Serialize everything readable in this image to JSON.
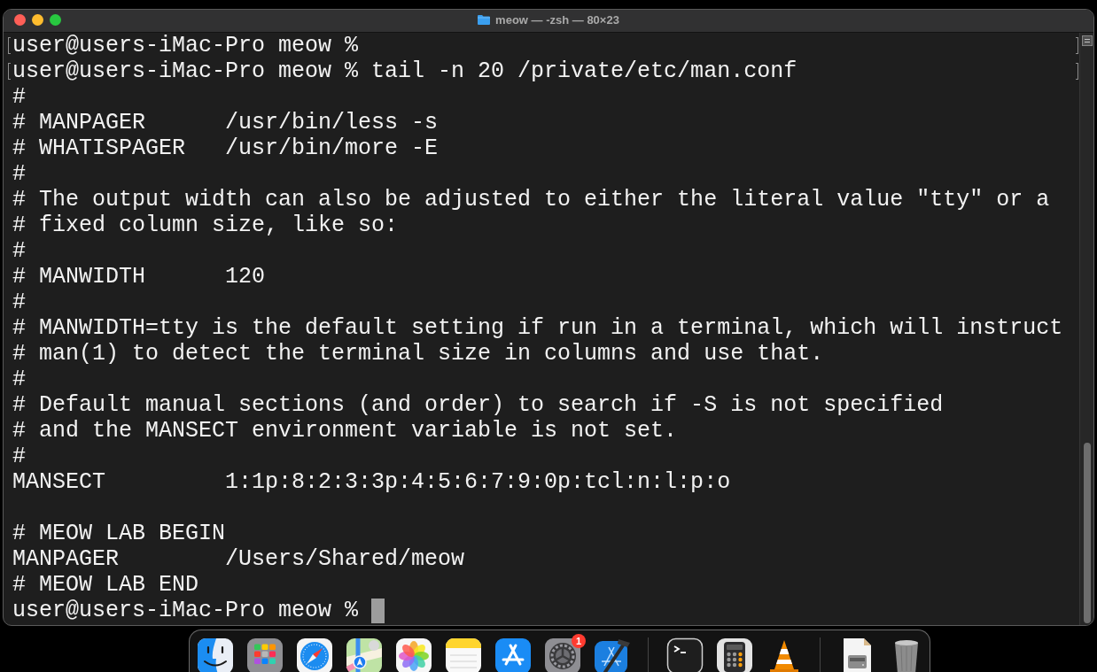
{
  "window": {
    "title": "meow — -zsh — 80×23"
  },
  "terminal": {
    "lines": [
      {
        "kind": "text",
        "text": "user@users-iMac-Pro meow %",
        "marked": true
      },
      {
        "kind": "text",
        "text": "user@users-iMac-Pro meow % tail -n 20 /private/etc/man.conf",
        "marked": true
      },
      {
        "kind": "text",
        "text": "#",
        "marked": false
      },
      {
        "kind": "text",
        "text": "# MANPAGER      /usr/bin/less -s",
        "marked": false
      },
      {
        "kind": "text",
        "text": "# WHATISPAGER   /usr/bin/more -E",
        "marked": false
      },
      {
        "kind": "text",
        "text": "#",
        "marked": false
      },
      {
        "kind": "text",
        "text": "# The output width can also be adjusted to either the literal value \"tty\" or a",
        "marked": false
      },
      {
        "kind": "text",
        "text": "# fixed column size, like so:",
        "marked": false
      },
      {
        "kind": "text",
        "text": "#",
        "marked": false
      },
      {
        "kind": "text",
        "text": "# MANWIDTH      120",
        "marked": false
      },
      {
        "kind": "text",
        "text": "#",
        "marked": false
      },
      {
        "kind": "text",
        "text": "# MANWIDTH=tty is the default setting if run in a terminal, which will instruct",
        "marked": false
      },
      {
        "kind": "text",
        "text": "# man(1) to detect the terminal size in columns and use that.",
        "marked": false
      },
      {
        "kind": "text",
        "text": "#",
        "marked": false
      },
      {
        "kind": "text",
        "text": "# Default manual sections (and order) to search if -S is not specified",
        "marked": false
      },
      {
        "kind": "text",
        "text": "# and the MANSECT environment variable is not set.",
        "marked": false
      },
      {
        "kind": "text",
        "text": "#",
        "marked": false
      },
      {
        "kind": "text",
        "text": "MANSECT         1:1p:8:2:3:3p:4:5:6:7:9:0p:tcl:n:l:p:o",
        "marked": false
      },
      {
        "kind": "blank",
        "marked": false
      },
      {
        "kind": "text",
        "text": "# MEOW LAB BEGIN",
        "marked": false
      },
      {
        "kind": "text",
        "text": "MANPAGER        /Users/Shared/meow",
        "marked": false
      },
      {
        "kind": "text",
        "text": "# MEOW LAB END",
        "marked": false
      }
    ],
    "input": {
      "prompt": "user@users-iMac-Pro meow %",
      "cursor": true
    }
  },
  "dock": {
    "badge": "1"
  }
}
